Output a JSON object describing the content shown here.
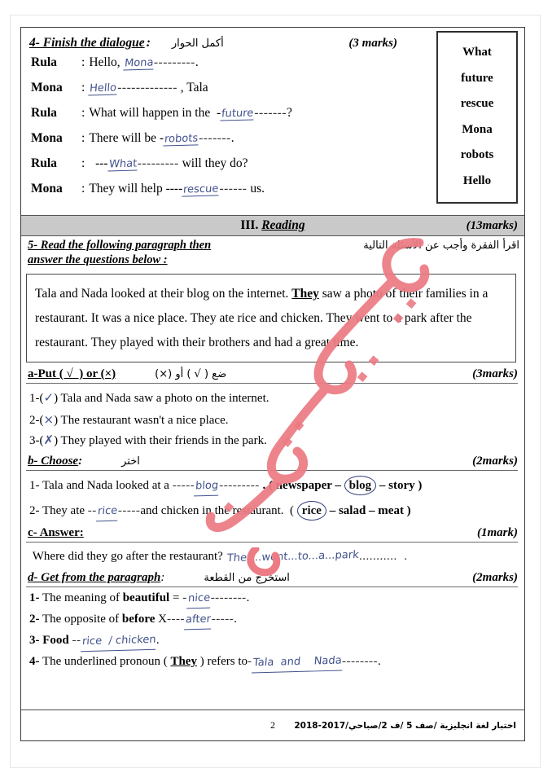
{
  "page": {
    "number": "2",
    "footer_ar": "اختبار لغة انجليزية /صف 5 /ف 2/صباحي/2017-2018"
  },
  "question4": {
    "label": "4- Finish the dialogue",
    "colon": ":",
    "arabic": "أكمل الحوار",
    "marks": "(3 marks)",
    "lines": [
      {
        "speaker": "Rula",
        "sep": ":",
        "before": "Hello, ",
        "answer": "Mona",
        "dots": "---------",
        "after": "."
      },
      {
        "speaker": "Mona",
        "sep": ":",
        "before": "",
        "answer": "Hello",
        "dots": "-------------",
        "after": " , Tala"
      },
      {
        "speaker": "Rula",
        "sep": ":",
        "before": "What will happen in the  -",
        "answer": "future",
        "dots": "-------",
        "after": "?"
      },
      {
        "speaker": "Mona",
        "sep": ":",
        "before": "There will be -",
        "answer": "robots",
        "dots": "-------",
        "after": "."
      },
      {
        "speaker": "Rula",
        "sep": ":",
        "before": "  ---",
        "answer": "What",
        "dots": "---------",
        "after": " will they do?"
      },
      {
        "speaker": "Mona",
        "sep": ":",
        "before": "They will help ----",
        "answer": "rescue",
        "dots": "------",
        "after": " us."
      }
    ]
  },
  "wordbank": {
    "words": [
      "What",
      "future",
      "rescue",
      "Mona",
      "robots",
      "Hello"
    ]
  },
  "reading_band": {
    "numeral": "III.",
    "title": "Reading",
    "marks": "(13marks)"
  },
  "question5": {
    "line1": "5- Read the following paragraph then",
    "line2": "answer the questions below :",
    "arabic": "اقرأ الفقرة وأجب عن الأسئلة التالية",
    "paragraph_parts": [
      {
        "text": "Tala and Nada looked at their blog on the internet. ",
        "style": "normal"
      },
      {
        "text": "They",
        "style": "bold-underline"
      },
      {
        "text": " saw a photo of their families in a restaurant. It was a nice place. They ate rice and chicken. They went to a park after the restaurant. They played with their brothers and had a great time.",
        "style": "normal"
      }
    ]
  },
  "part_a": {
    "label": "a-Put ( √  ) or (×)",
    "arabic": "ضع ( √ ) أو (×)",
    "marks": "(3marks)",
    "items": [
      {
        "num": "1-(",
        "mark": "✓",
        "close": ")",
        "text": " Tala and Nada saw a photo on the internet."
      },
      {
        "num": "2-(",
        "mark": "×",
        "close": ")",
        "text": " The restaurant wasn't a nice place."
      },
      {
        "num": "3-(",
        "mark": "✗",
        "close": ")",
        "text": " They played with their friends in the park."
      }
    ]
  },
  "part_b": {
    "label": "b- Choose",
    "colon": ":",
    "arabic": "اختر",
    "marks": "(2marks)",
    "items": [
      {
        "pre": "1- Tala and Nada looked at a ",
        "dash": "-----",
        "answer": "blog",
        "dots": "---------",
        "mid": " . ( newspaper – ",
        "circled": "blog",
        "post": " – story )"
      },
      {
        "pre": "2- They ate ",
        "dash": "--",
        "answer": "rice",
        "dots": "-----",
        "mid": "and chicken in the restaurant.  ( ",
        "circled": "rice",
        "post": " – salad – meat )"
      }
    ]
  },
  "part_c": {
    "label": "c- Answer",
    "colon": ":",
    "marks": "(1mark)",
    "question": " Where did they go after the restaurant? ",
    "answer": "They...went...to...a...park",
    "dots": "...........  ."
  },
  "part_d": {
    "label": "d- Get from the paragraph",
    "colon": ":",
    "arabic": "استخرج من القطعة",
    "marks": "(2marks)",
    "items": [
      {
        "num": "1-",
        "pre": " The meaning of ",
        "kw": "beautiful",
        "mid": " = ",
        "dash": "-",
        "answer": "nice",
        "dots": "--------",
        "post": "."
      },
      {
        "num": "2-",
        "pre": " The opposite of ",
        "kw": "before",
        "mid": " X",
        "dash": "----",
        "answer": "after",
        "dots": "-----",
        "post": "."
      },
      {
        "num": "3-",
        "pre": " ",
        "kw": "Food",
        "mid": " ",
        "dash": "--",
        "answer": "rice  / chicken",
        "dots": "",
        "post": "."
      },
      {
        "num": "4-",
        "pre": " The underlined pronoun ( ",
        "kw": "They",
        "mid": " ) refers to",
        "dash": "-",
        "answer": "Tala  and    Nada",
        "dots": "--------",
        "post": "."
      }
    ]
  },
  "colors": {
    "ink_blue": "#41518c",
    "red_annotation": "#e8707a",
    "band_gray": "#c9c9c9"
  }
}
